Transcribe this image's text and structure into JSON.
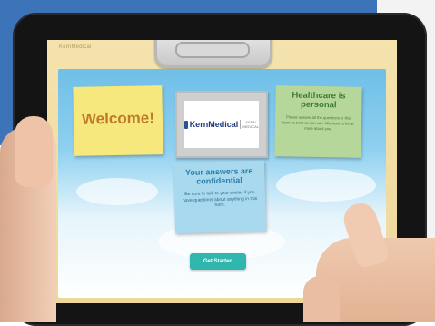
{
  "app": {
    "logo_text": "KernMedical"
  },
  "notes": {
    "welcome": {
      "title": "Welcome!"
    },
    "logo": {
      "name": "KernMedical",
      "tagline": "KERN MEDICAL"
    },
    "healthcare": {
      "title": "Healthcare is personal",
      "body": "Please answer all the questions in this form as best as you can. We want to know more about you."
    },
    "confidential": {
      "title": "Your answers are confidential",
      "body": "Be sure to talk to your doctor if you have questions about anything in this form."
    }
  },
  "actions": {
    "get_started": "Get Started"
  },
  "colors": {
    "brand_teal": "#2fb7ad",
    "note_yellow": "#f6e87c",
    "note_green": "#b6d79a",
    "note_blue": "#a8d9ef",
    "brand_navy": "#1f3c80"
  }
}
